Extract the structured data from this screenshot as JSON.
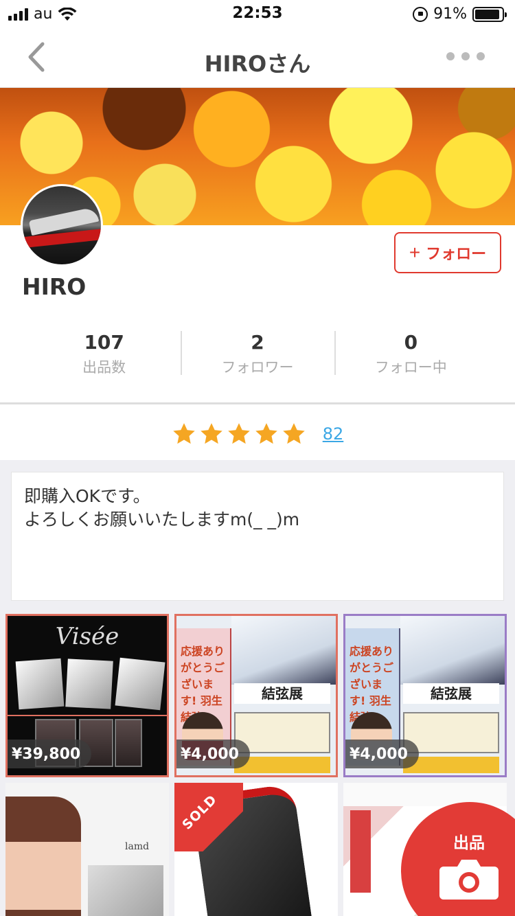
{
  "status_bar": {
    "carrier": "au",
    "time": "22:53",
    "battery_pct": "91%",
    "battery_level": 0.91
  },
  "nav": {
    "title": "HIROさん"
  },
  "profile": {
    "username": "HIRO",
    "follow_label": "フォロー",
    "follow_plus": "+"
  },
  "stats": [
    {
      "value": "107",
      "label": "出品数"
    },
    {
      "value": "2",
      "label": "フォロワー"
    },
    {
      "value": "0",
      "label": "フォロー中"
    }
  ],
  "rating": {
    "stars": 5,
    "count": "82",
    "star_color": "#f5a623"
  },
  "intro": {
    "line1": "即購入OKです。",
    "line2": "よろしくお願いいたしますm(_ _)m"
  },
  "items": [
    {
      "price": "¥39,800"
    },
    {
      "price": "¥4,000"
    },
    {
      "price": "¥4,000"
    },
    {
      "price": ""
    },
    {
      "price": "",
      "sold_label": "SOLD"
    },
    {
      "price": ""
    }
  ],
  "item_image_text": {
    "visee_brand": "Visée",
    "poster_title": "結弦展",
    "poster_side": "応援ありがとうございます! 羽生結弦",
    "namie_brand": "lamd"
  },
  "sell_button": {
    "label": "出品"
  },
  "colors": {
    "accent_red": "#e23b36",
    "link_blue": "#3ba7e5"
  }
}
